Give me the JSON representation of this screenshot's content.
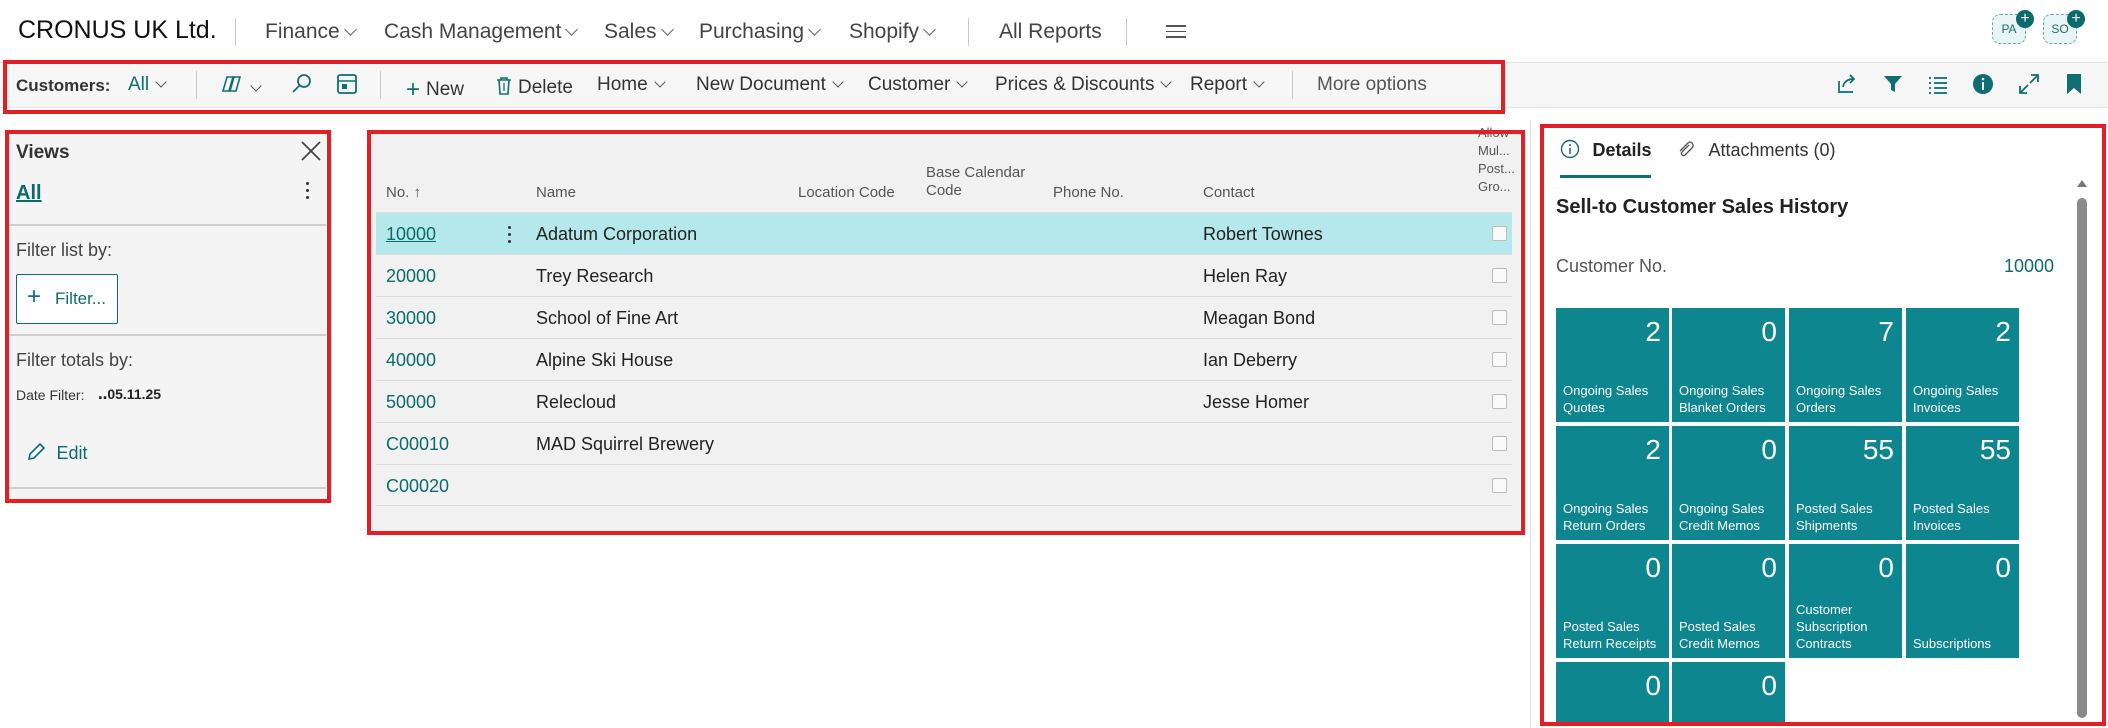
{
  "topnav": {
    "company": "CRONUS UK Ltd.",
    "menus": [
      "Finance",
      "Cash Management",
      "Sales",
      "Purchasing",
      "Shopify"
    ],
    "all_reports": "All Reports",
    "avatars": [
      "PA",
      "SO"
    ]
  },
  "actionbar": {
    "customers_label": "Customers:",
    "view_filter": "All",
    "new": "New",
    "delete": "Delete",
    "home": "Home",
    "new_document": "New Document",
    "customer": "Customer",
    "prices_discounts": "Prices & Discounts",
    "report": "Report",
    "more_options": "More options"
  },
  "views": {
    "title": "Views",
    "active_view": "All",
    "filter_list_by": "Filter list by:",
    "filter_button": "Filter...",
    "filter_totals_by": "Filter totals by:",
    "date_filter_label": "Date Filter:",
    "date_filter_value": "‥05.11.25",
    "edit": "Edit"
  },
  "list": {
    "columns": {
      "no": "No. ↑",
      "name": "Name",
      "location_code": "Location Code",
      "base_calendar_code_1": "Base Calendar",
      "base_calendar_code_2": "Code",
      "phone": "Phone No.",
      "contact": "Contact",
      "allow_1": "Allow",
      "allow_2": "Mul...",
      "allow_3": "Post...",
      "allow_4": "Gro..."
    },
    "rows": [
      {
        "no": "10000",
        "name": "Adatum Corporation",
        "contact": "Robert Townes"
      },
      {
        "no": "20000",
        "name": "Trey Research",
        "contact": "Helen Ray"
      },
      {
        "no": "30000",
        "name": "School of Fine Art",
        "contact": "Meagan Bond"
      },
      {
        "no": "40000",
        "name": "Alpine Ski House",
        "contact": "Ian Deberry"
      },
      {
        "no": "50000",
        "name": "Relecloud",
        "contact": "Jesse Homer"
      },
      {
        "no": "C00010",
        "name": "MAD Squirrel Brewery",
        "contact": ""
      },
      {
        "no": "C00020",
        "name": "",
        "contact": ""
      }
    ]
  },
  "details": {
    "tab_details": "Details",
    "tab_attachments": "Attachments (0)",
    "section_title": "Sell-to Customer Sales History",
    "customer_no_label": "Customer No.",
    "customer_no_value": "10000",
    "tiles": [
      {
        "value": "2",
        "label_1": "Ongoing Sales",
        "label_2": "Quotes",
        "label_3": ""
      },
      {
        "value": "0",
        "label_1": "Ongoing Sales",
        "label_2": "Blanket Orders",
        "label_3": ""
      },
      {
        "value": "7",
        "label_1": "Ongoing Sales",
        "label_2": "Orders",
        "label_3": ""
      },
      {
        "value": "2",
        "label_1": "Ongoing Sales",
        "label_2": "Invoices",
        "label_3": ""
      },
      {
        "value": "2",
        "label_1": "Ongoing Sales",
        "label_2": "Return Orders",
        "label_3": ""
      },
      {
        "value": "0",
        "label_1": "Ongoing Sales",
        "label_2": "Credit Memos",
        "label_3": ""
      },
      {
        "value": "55",
        "label_1": "Posted Sales",
        "label_2": "Shipments",
        "label_3": ""
      },
      {
        "value": "55",
        "label_1": "Posted Sales",
        "label_2": "Invoices",
        "label_3": ""
      },
      {
        "value": "0",
        "label_1": "Posted Sales",
        "label_2": "Return Receipts",
        "label_3": ""
      },
      {
        "value": "0",
        "label_1": "Posted Sales",
        "label_2": "Credit Memos",
        "label_3": ""
      },
      {
        "value": "0",
        "label_1": "Customer",
        "label_2": "Subscription",
        "label_3": "Contracts"
      },
      {
        "value": "0",
        "label_1": "Subscriptions",
        "label_2": "",
        "label_3": ""
      },
      {
        "value": "0",
        "label_1": "",
        "label_2": "",
        "label_3": ""
      },
      {
        "value": "0",
        "label_1": "",
        "label_2": "",
        "label_3": ""
      }
    ]
  },
  "colors": {
    "accent": "#0e6e73",
    "tile": "#0e8690",
    "selected_row": "#b5e8ea",
    "highlight_box": "#e31e24"
  }
}
